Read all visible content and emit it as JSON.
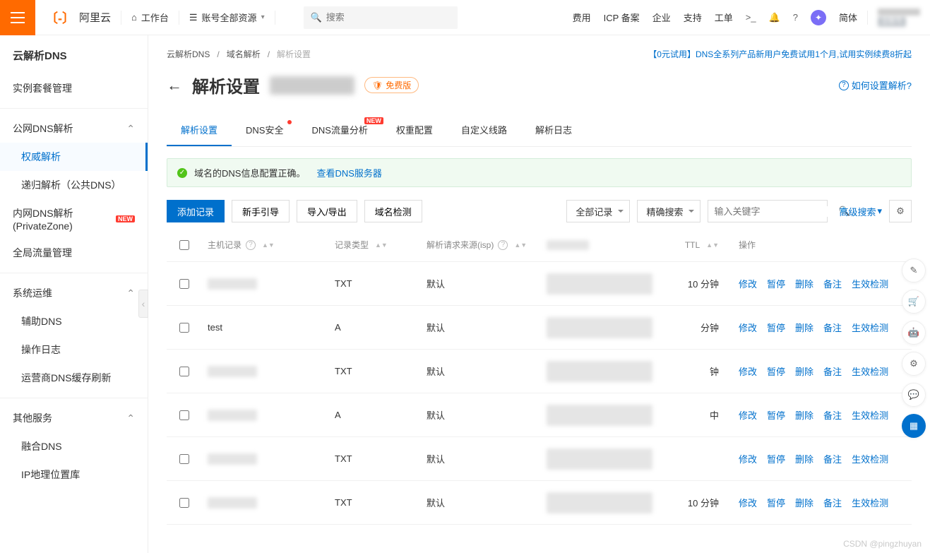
{
  "top": {
    "brand": "阿里云",
    "workbench": "工作台",
    "resources": "账号全部资源",
    "search_placeholder": "搜索",
    "links": [
      "费用",
      "ICP 备案",
      "企业",
      "支持",
      "工单"
    ],
    "lang": "简体",
    "account_label": "主账号"
  },
  "sidebar": {
    "title": "云解析DNS",
    "i0": "实例套餐管理",
    "g1": "公网DNS解析",
    "g1a": "权威解析",
    "g1b": "递归解析（公共DNS）",
    "i2": "内网DNS解析 (PrivateZone)",
    "i3": "全局流量管理",
    "g2": "系统运维",
    "g2a": "辅助DNS",
    "g2b": "操作日志",
    "g2c": "运营商DNS缓存刷新",
    "g3": "其他服务",
    "g3a": "融合DNS",
    "g3b": "IP地理位置库"
  },
  "breadcrumb": {
    "a": "云解析DNS",
    "b": "域名解析",
    "c": "解析设置"
  },
  "promo": "【0元试用】DNS全系列产品新用户免费试用1个月,试用实例续费8折起",
  "page": {
    "title": "解析设置",
    "free": "免费版",
    "help": "如何设置解析?"
  },
  "tabs": [
    "解析设置",
    "DNS安全",
    "DNS流量分析",
    "权重配置",
    "自定义线路",
    "解析日志"
  ],
  "banner": {
    "text": "域名的DNS信息配置正确。",
    "link": "查看DNS服务器"
  },
  "actions": {
    "add": "添加记录",
    "guide": "新手引导",
    "io": "导入/导出",
    "check": "域名检测",
    "allrec": "全部记录",
    "exact": "精确搜索",
    "kw_placeholder": "输入关键字",
    "adv": "高级搜索"
  },
  "columns": {
    "host": "主机记录",
    "type": "记录类型",
    "isp": "解析请求来源(isp)",
    "ttl": "TTL",
    "ops": "操作"
  },
  "ops": {
    "edit": "修改",
    "pause": "暂停",
    "del": "删除",
    "note": "备注",
    "check": "生效检测"
  },
  "rows": [
    {
      "host": "",
      "type": "TXT",
      "isp": "默认",
      "val": "",
      "ttl": "10 分钟"
    },
    {
      "host": "test",
      "type": "A",
      "isp": "默认",
      "val": "ip",
      "ttl": "分钟",
      "highlight": true
    },
    {
      "host": "",
      "type": "TXT",
      "isp": "默认",
      "val": "",
      "ttl": "钟"
    },
    {
      "host": "",
      "type": "A",
      "isp": "默认",
      "val": "",
      "ttl": "中"
    },
    {
      "host": "",
      "type": "TXT",
      "isp": "默认",
      "val": "",
      "ttl": ""
    },
    {
      "host": "",
      "type": "TXT",
      "isp": "默认",
      "val": "",
      "ttl": "10 分钟"
    }
  ],
  "watermark": "CSDN @pingzhuyan"
}
